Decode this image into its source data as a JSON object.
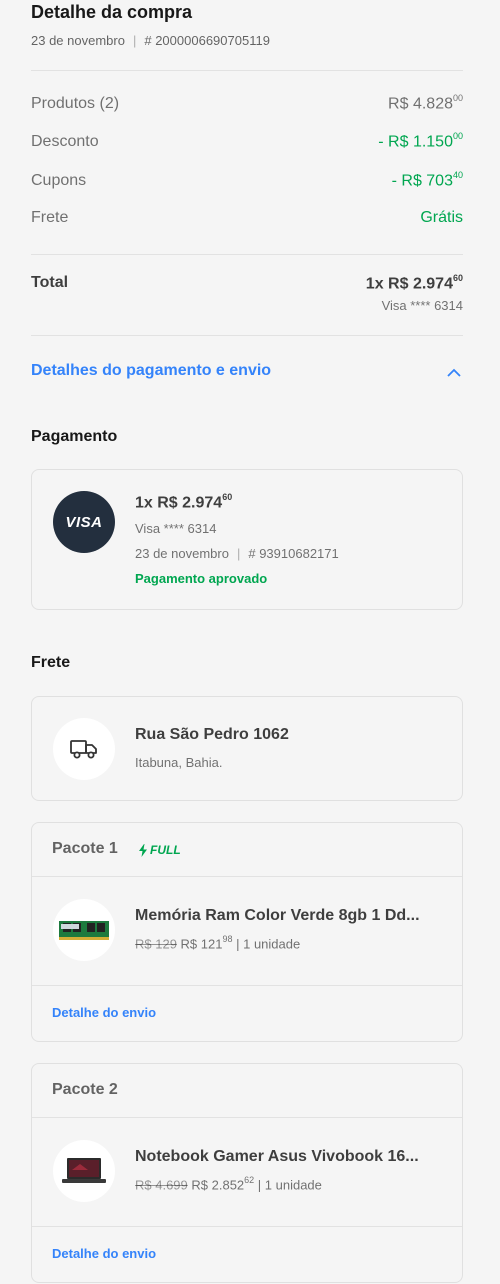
{
  "header": {
    "title": "Detalhe da compra",
    "date": "23 de novembro",
    "order_prefix": "#",
    "order_number": "2000006690705119"
  },
  "summary": {
    "products_label": "Produtos (2)",
    "products_value": "R$ 4.828",
    "products_cents": "00",
    "discount_label": "Desconto",
    "discount_value": "- R$ 1.150",
    "discount_cents": "00",
    "coupons_label": "Cupons",
    "coupons_value": "- R$ 703",
    "coupons_cents": "40",
    "shipping_label": "Frete",
    "shipping_value": "Grátis",
    "total_label": "Total",
    "total_value": "1x R$ 2.974",
    "total_cents": "60",
    "total_card": "Visa **** 6314"
  },
  "details_toggle": {
    "label": "Detalhes do pagamento e envio",
    "icon": "chevron-up-icon"
  },
  "payment": {
    "section_title": "Pagamento",
    "brand": "VISA",
    "amount": "1x R$ 2.974",
    "amount_cents": "60",
    "card": "Visa **** 6314",
    "date": "23 de novembro",
    "tx_prefix": "#",
    "tx_number": "93910682171",
    "status": "Pagamento aprovado"
  },
  "shipping": {
    "section_title": "Frete",
    "address": "Rua São Pedro 1062",
    "city": "Itabuna, Bahia.",
    "icon": "truck-icon"
  },
  "packages": [
    {
      "title": "Pacote 1",
      "badge": "FULL",
      "product_name": "Memória Ram Color Verde 8gb 1 Dd...",
      "old_price": "R$ 129",
      "price": "R$ 121",
      "price_cents": "98",
      "qty": "| 1 unidade",
      "link": "Detalhe do envio"
    },
    {
      "title": "Pacote 2",
      "product_name": "Notebook Gamer Asus Vivobook 16...",
      "old_price": "R$ 4.699",
      "price": "R$ 2.852",
      "price_cents": "62",
      "qty": "| 1 unidade",
      "link": "Detalhe do envio"
    }
  ],
  "colors": {
    "accent_blue": "#3483fa",
    "success_green": "#00a650",
    "visa_bg": "#232f3e",
    "background": "#f5f5f5"
  }
}
